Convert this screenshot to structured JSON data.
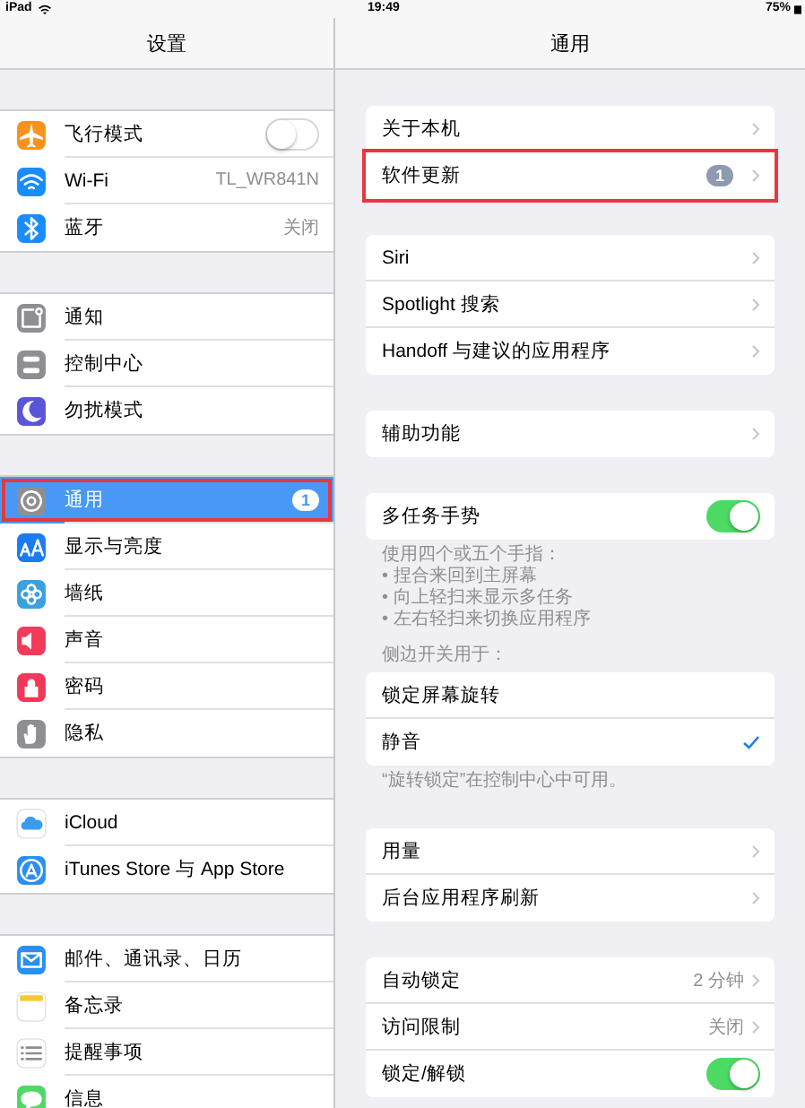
{
  "status_bar": {
    "device": "iPad",
    "time": "19:49",
    "battery": "75%"
  },
  "settings_pane": {
    "title": "设置",
    "groups": [
      [
        {
          "label": "飞行模式",
          "kind": "toggle",
          "on": false,
          "color": "#f7931e",
          "selected": false,
          "marked": false
        },
        {
          "label": "Wi-Fi",
          "kind": "value",
          "value": "TL_WR841N",
          "color": "#1a8cff",
          "selected": false,
          "marked": false
        },
        {
          "label": "蓝牙",
          "kind": "value",
          "value": "关闭",
          "color": "#1a8cff",
          "selected": false,
          "marked": false
        }
      ],
      [
        {
          "label": "通知",
          "kind": "plain",
          "color": "#8e8e93",
          "selected": false,
          "marked": false
        },
        {
          "label": "控制中心",
          "kind": "plain",
          "color": "#8e8e93",
          "selected": false,
          "marked": false
        },
        {
          "label": "勿扰模式",
          "kind": "plain",
          "color": "#5856d6",
          "selected": false,
          "marked": false
        }
      ],
      [
        {
          "label": "通用",
          "kind": "badge",
          "badge": "1",
          "color": "#8e8e93",
          "selected": true,
          "marked": true
        },
        {
          "label": "显示与亮度",
          "kind": "plain",
          "color": "#1a7cf0",
          "selected": false,
          "marked": false
        },
        {
          "label": "墙纸",
          "kind": "plain",
          "color": "#3aa0e0",
          "selected": false,
          "marked": false
        },
        {
          "label": "声音",
          "kind": "plain",
          "color": "#f23a5a",
          "selected": false,
          "marked": false
        },
        {
          "label": "密码",
          "kind": "plain",
          "color": "#f2385a",
          "selected": false,
          "marked": false
        },
        {
          "label": "隐私",
          "kind": "plain",
          "color": "#8e8e93",
          "selected": false,
          "marked": false
        }
      ],
      [
        {
          "label": "iCloud",
          "kind": "plain",
          "selected": false,
          "marked": false
        },
        {
          "label": "iTunes Store 与 App Store",
          "kind": "plain",
          "color": "#2a8ff0",
          "selected": false,
          "marked": false
        }
      ],
      [
        {
          "label": "邮件、通讯录、日历",
          "kind": "plain",
          "color": "#2a8ff0",
          "selected": false,
          "marked": false
        },
        {
          "label": "备忘录",
          "kind": "plain",
          "selected": false,
          "marked": false
        },
        {
          "label": "提醒事项",
          "kind": "plain",
          "selected": false,
          "marked": false
        },
        {
          "label": "信息",
          "kind": "plain",
          "color": "#4cd964",
          "selected": false,
          "marked": false
        }
      ]
    ]
  },
  "general_pane": {
    "title": "通用",
    "groups": [
      {
        "rows": [
          {
            "label": "关于本机",
            "kind": "link",
            "marked": false
          },
          {
            "label": "软件更新",
            "kind": "badge",
            "badge": "1",
            "marked": true
          }
        ]
      },
      {
        "rows": [
          {
            "label": "Siri",
            "kind": "link",
            "marked": false
          },
          {
            "label": "Spotlight 搜索",
            "kind": "link",
            "marked": false
          },
          {
            "label": "Handoff 与建议的应用程序",
            "kind": "link",
            "marked": false
          }
        ]
      },
      {
        "rows": [
          {
            "label": "辅助功能",
            "kind": "link",
            "marked": false
          }
        ]
      },
      {
        "rows": [
          {
            "label": "多任务手势",
            "kind": "toggle",
            "on": true,
            "marked": false
          }
        ],
        "footer": [
          "使用四个或五个手指：",
          "• 捏合来回到主屏幕",
          "• 向上轻扫来显示多任务",
          "• 左右轻扫来切换应用程序"
        ]
      },
      {
        "header": "侧边开关用于：",
        "rows": [
          {
            "label": "锁定屏幕旋转",
            "kind": "check",
            "checked": false,
            "marked": false
          },
          {
            "label": "静音",
            "kind": "check",
            "checked": true,
            "marked": false
          }
        ],
        "footer": [
          "“旋转锁定”在控制中心中可用。"
        ]
      },
      {
        "rows": [
          {
            "label": "用量",
            "kind": "link",
            "marked": false
          },
          {
            "label": "后台应用程序刷新",
            "kind": "link",
            "marked": false
          }
        ]
      },
      {
        "rows": [
          {
            "label": "自动锁定",
            "kind": "value",
            "value": "2 分钟",
            "marked": false
          },
          {
            "label": "访问限制",
            "kind": "value",
            "value": "关闭",
            "marked": false
          },
          {
            "label": "锁定/解锁",
            "kind": "toggle",
            "on": true,
            "marked": false
          }
        ]
      }
    ]
  }
}
